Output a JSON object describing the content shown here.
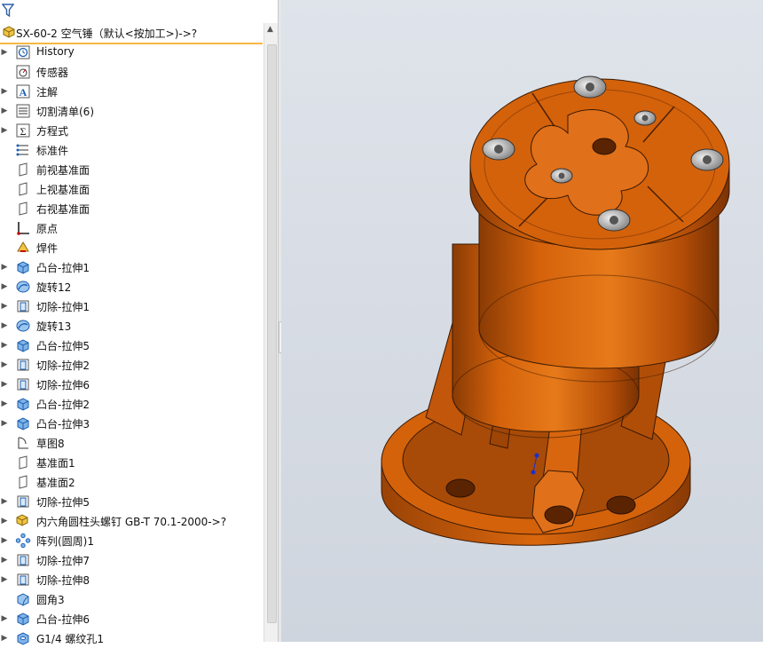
{
  "tree": {
    "root": {
      "label": "SX-60-2 空气锤（默认<按加工>)->?"
    },
    "items": [
      {
        "label": "History",
        "icon": "history-icon",
        "expand": true
      },
      {
        "label": "传感器",
        "icon": "sensor-icon",
        "expand": false
      },
      {
        "label": "注解",
        "icon": "annotation-icon",
        "expand": true
      },
      {
        "label": "切割清单(6)",
        "icon": "cut-list-icon",
        "expand": true
      },
      {
        "label": "方程式",
        "icon": "equation-icon",
        "expand": true
      },
      {
        "label": "标准件",
        "icon": "standard-part-icon",
        "expand": false
      },
      {
        "label": "前视基准面",
        "icon": "plane-icon",
        "expand": false
      },
      {
        "label": "上视基准面",
        "icon": "plane-icon",
        "expand": false
      },
      {
        "label": "右视基准面",
        "icon": "plane-icon",
        "expand": false
      },
      {
        "label": "原点",
        "icon": "origin-icon",
        "expand": false
      },
      {
        "label": "焊件",
        "icon": "weldment-icon",
        "expand": false
      },
      {
        "label": "凸台-拉伸1",
        "icon": "boss-extrude-icon",
        "expand": true
      },
      {
        "label": "旋转12",
        "icon": "revolve-icon",
        "expand": true
      },
      {
        "label": "切除-拉伸1",
        "icon": "cut-extrude-icon",
        "expand": true
      },
      {
        "label": "旋转13",
        "icon": "revolve-icon",
        "expand": true
      },
      {
        "label": "凸台-拉伸5",
        "icon": "boss-extrude-icon",
        "expand": true
      },
      {
        "label": "切除-拉伸2",
        "icon": "cut-extrude-icon",
        "expand": true
      },
      {
        "label": "切除-拉伸6",
        "icon": "cut-extrude-icon",
        "expand": true
      },
      {
        "label": "凸台-拉伸2",
        "icon": "boss-extrude-icon",
        "expand": true
      },
      {
        "label": "凸台-拉伸3",
        "icon": "boss-extrude-icon",
        "expand": true
      },
      {
        "label": "草图8",
        "icon": "sketch-icon",
        "expand": false
      },
      {
        "label": "基准面1",
        "icon": "plane-icon",
        "expand": false
      },
      {
        "label": "基准面2",
        "icon": "plane-icon",
        "expand": false
      },
      {
        "label": "切除-拉伸5",
        "icon": "cut-extrude-icon",
        "expand": true
      },
      {
        "label": "内六角圆柱头螺钉 GB-T 70.1-2000->?",
        "icon": "screw-part-icon",
        "expand": true
      },
      {
        "label": "阵列(圆周)1",
        "icon": "circular-pattern-icon",
        "expand": true
      },
      {
        "label": "切除-拉伸7",
        "icon": "cut-extrude-icon",
        "expand": true
      },
      {
        "label": "切除-拉伸8",
        "icon": "cut-extrude-icon",
        "expand": true
      },
      {
        "label": "圆角3",
        "icon": "fillet-icon",
        "expand": false
      },
      {
        "label": "凸台-拉伸6",
        "icon": "boss-extrude-icon",
        "expand": true
      },
      {
        "label": "G1/4 螺纹孔1",
        "icon": "hole-icon",
        "expand": true
      }
    ]
  },
  "colors": {
    "part_orange": "#d4620b",
    "viewport_bg": "#d6dbe3",
    "selection": "#f5b742"
  }
}
